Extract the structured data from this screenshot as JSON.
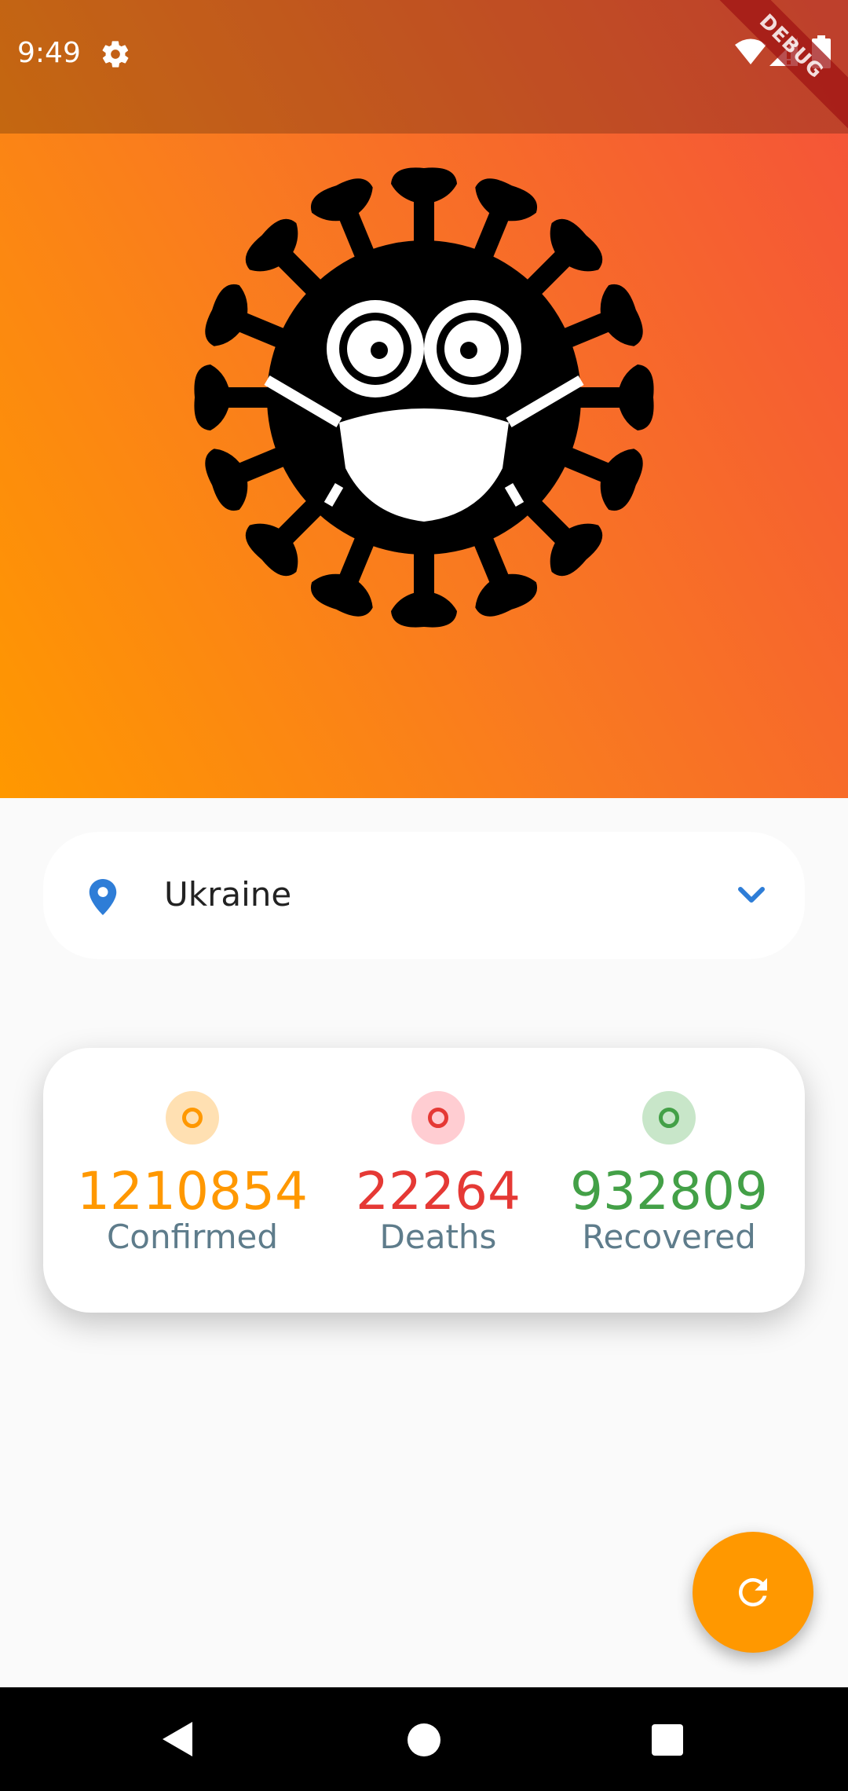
{
  "status_bar": {
    "time": "9:49",
    "icons": [
      "settings-icon",
      "wifi-icon",
      "signal-icon",
      "battery-icon"
    ],
    "debug_banner": "DEBUG"
  },
  "header": {
    "image": "virus-mask-mascot",
    "gradient_colors": [
      "#ff9800",
      "#f97a20",
      "#f4513a"
    ]
  },
  "country_select": {
    "icon": "location-pin-icon",
    "selected": "Ukraine",
    "dropdown_icon": "chevron-down-icon"
  },
  "stats": [
    {
      "value": "1210854",
      "label": "Confirmed",
      "color": "#ff9800",
      "bg": "#ffe0b2"
    },
    {
      "value": "22264",
      "label": "Deaths",
      "color": "#e53935",
      "bg": "#ffcdd2"
    },
    {
      "value": "932809",
      "label": "Recovered",
      "color": "#43a047",
      "bg": "#c8e6c9"
    }
  ],
  "fab": {
    "icon": "refresh-icon",
    "color": "#ff9800"
  },
  "nav_bar": {
    "icons": [
      "back-icon",
      "home-icon",
      "recents-icon"
    ]
  }
}
